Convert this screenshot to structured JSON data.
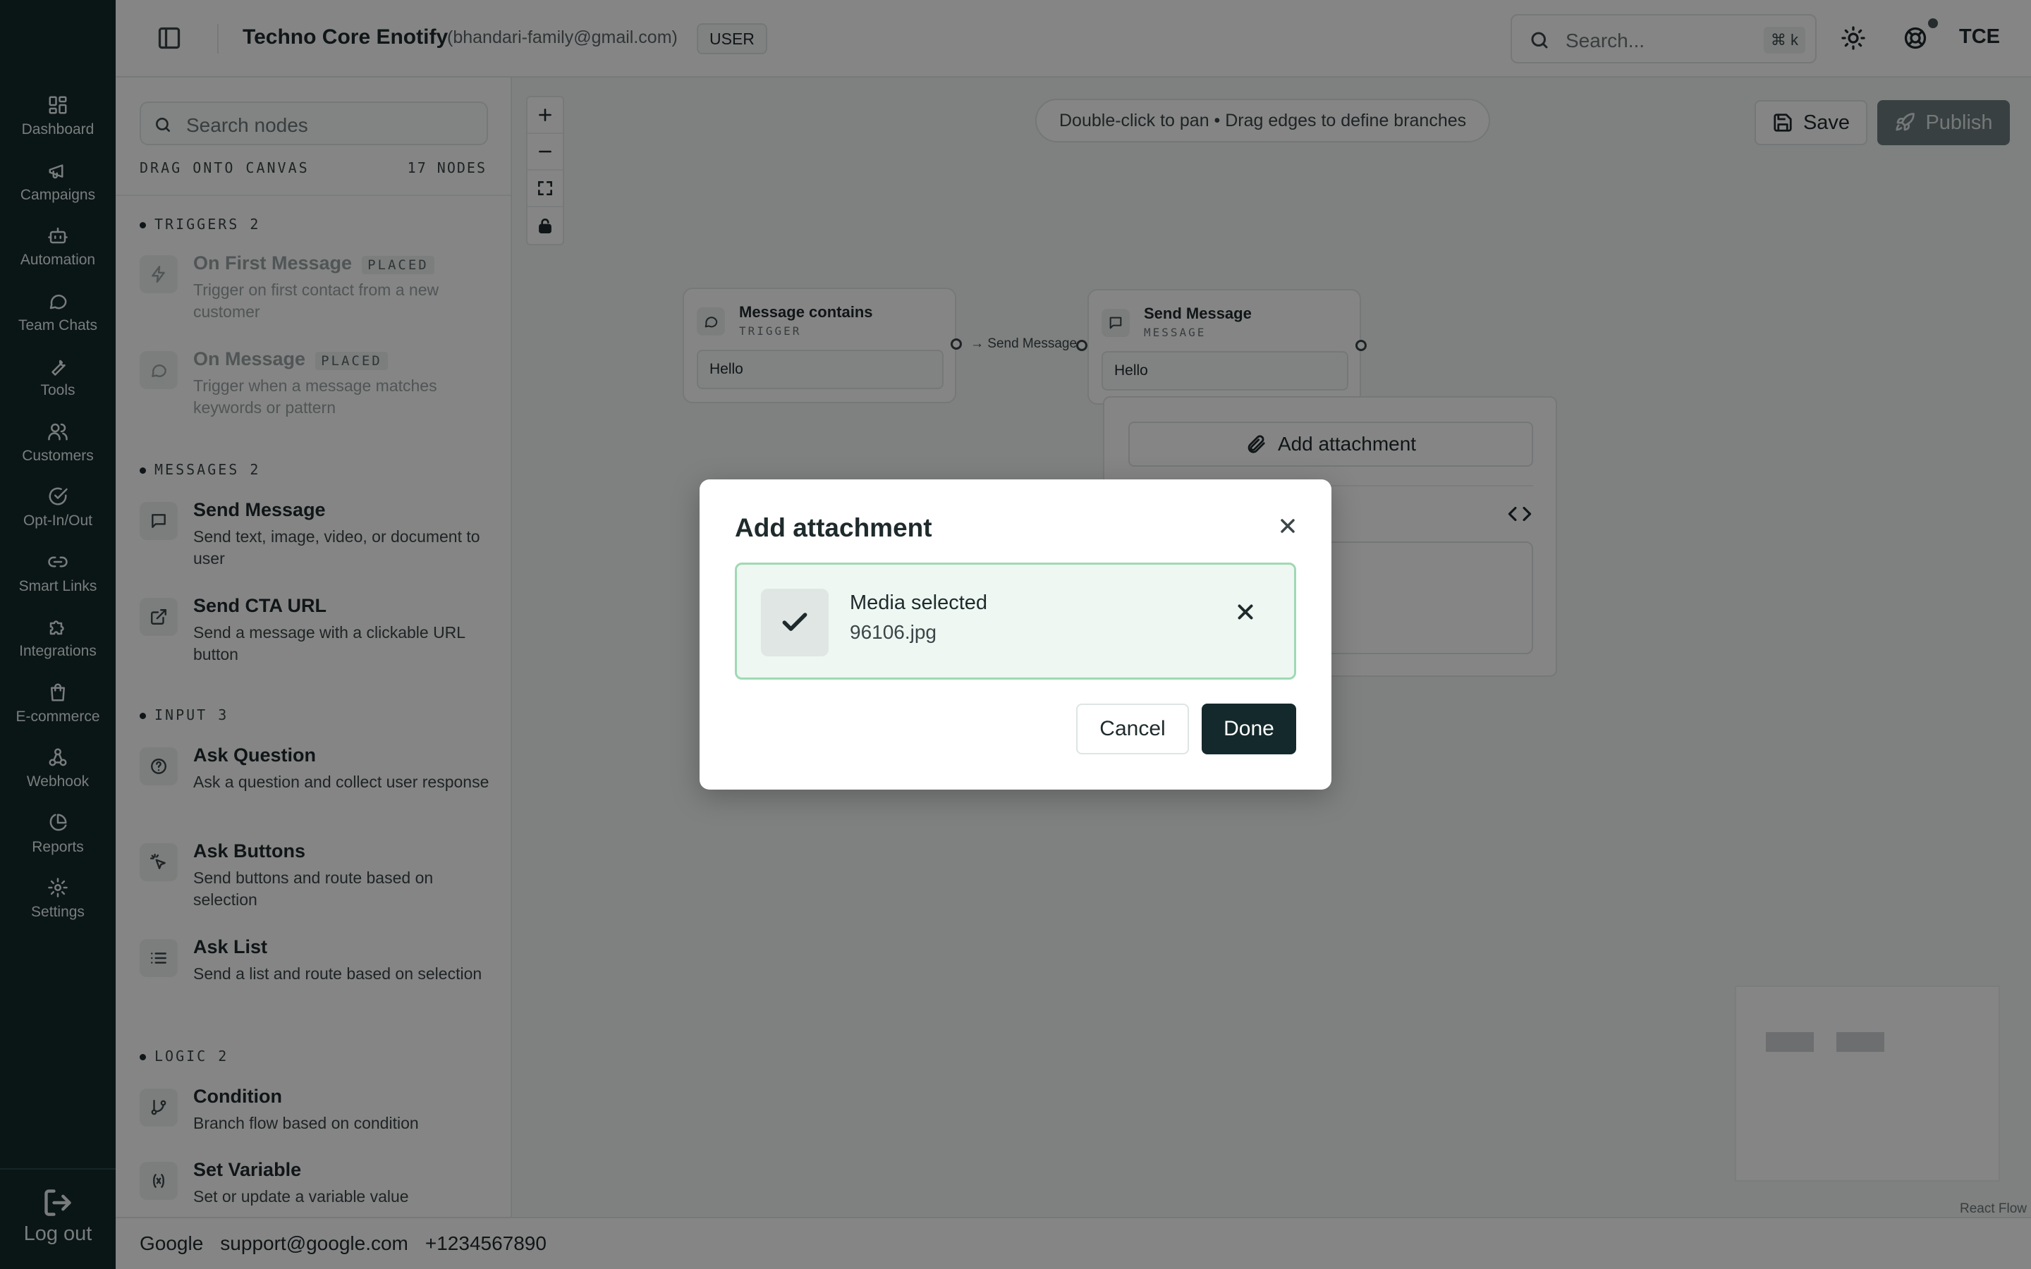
{
  "sidebar": {
    "items": [
      {
        "label": "Dashboard",
        "icon": "dashboard-icon"
      },
      {
        "label": "Campaigns",
        "icon": "megaphone-icon"
      },
      {
        "label": "Automation",
        "icon": "bot-icon"
      },
      {
        "label": "Team Chats",
        "icon": "chat-bubble-icon"
      },
      {
        "label": "Tools",
        "icon": "wrench-icon"
      },
      {
        "label": "Customers",
        "icon": "users-icon"
      },
      {
        "label": "Opt-In/Out",
        "icon": "check-circle-icon"
      },
      {
        "label": "Smart Links",
        "icon": "link-icon"
      },
      {
        "label": "Integrations",
        "icon": "puzzle-icon"
      },
      {
        "label": "E-commerce",
        "icon": "shopping-bag-icon"
      },
      {
        "label": "Webhook",
        "icon": "webhook-icon"
      },
      {
        "label": "Reports",
        "icon": "pie-chart-icon"
      },
      {
        "label": "Settings",
        "icon": "gear-icon"
      }
    ],
    "logout_label": "Log out"
  },
  "header": {
    "app_name": "Techno Core Enotify",
    "email": "(bhandari-family@gmail.com)",
    "role": "USER",
    "search_placeholder": "Search...",
    "search_shortcut": "⌘ k",
    "avatar_initials": "TCE"
  },
  "nodes_panel": {
    "search_placeholder": "Search nodes",
    "drag_hint": "DRAG ONTO CANVAS",
    "node_count": "17 NODES",
    "groups": [
      {
        "title": "TRIGGERS 2",
        "items": [
          {
            "name": "On First Message",
            "tag": "PLACED",
            "desc": "Trigger on first contact from a new customer"
          },
          {
            "name": "On Message",
            "tag": "PLACED",
            "desc": "Trigger when a message matches keywords or pattern"
          }
        ]
      },
      {
        "title": "MESSAGES 2",
        "items": [
          {
            "name": "Send Message",
            "desc": "Send text, image, video, or document to user"
          },
          {
            "name": "Send CTA URL",
            "desc": "Send a message with a clickable URL button"
          }
        ]
      },
      {
        "title": "INPUT 3",
        "items": [
          {
            "name": "Ask Question",
            "desc": "Ask a question and collect user response"
          },
          {
            "name": "Ask Buttons",
            "desc": "Send buttons and route based on selection"
          },
          {
            "name": "Ask List",
            "desc": "Send a list and route based on selection"
          }
        ]
      },
      {
        "title": "LOGIC 2",
        "items": [
          {
            "name": "Condition",
            "desc": "Branch flow based on condition"
          },
          {
            "name": "Set Variable",
            "desc": "Set or update a variable value"
          }
        ]
      }
    ]
  },
  "canvas": {
    "hint": "Double-click to pan • Drag edges to define branches",
    "save_label": "Save",
    "publish_label": "Publish",
    "nodes": [
      {
        "title": "Message contains",
        "subtitle": "TRIGGER",
        "value": "Hello"
      },
      {
        "title": "Send Message",
        "subtitle": "MESSAGE",
        "value": "Hello"
      }
    ],
    "edge_label": "→ Send Message",
    "attach_button_label": "Add attachment",
    "attribution": "React Flow"
  },
  "footer": {
    "company": "Google",
    "email": "support@google.com",
    "phone": "+1234567890"
  },
  "dialog": {
    "title": "Add attachment",
    "status": "Media selected",
    "filename": "96106.jpg",
    "cancel_label": "Cancel",
    "done_label": "Done",
    "success_border_color": "#9fd9b4",
    "primary_color": "#14292b"
  }
}
